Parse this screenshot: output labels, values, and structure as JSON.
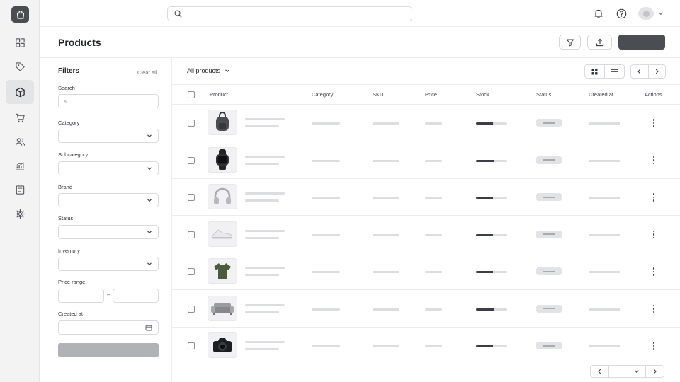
{
  "rail": {
    "items": [
      {
        "icon": "dashboard-grid-icon"
      },
      {
        "icon": "tag-icon"
      },
      {
        "icon": "box-icon",
        "active": true
      },
      {
        "icon": "cart-icon"
      },
      {
        "icon": "users-icon"
      },
      {
        "icon": "analytics-icon"
      },
      {
        "icon": "document-icon"
      },
      {
        "icon": "settings-icon"
      }
    ]
  },
  "topbar": {
    "search_placeholder": "",
    "icons": [
      "bell-icon",
      "help-icon"
    ]
  },
  "page": {
    "title": "Products",
    "primary_button_label": ""
  },
  "filters": {
    "title": "Filters",
    "clear_label": "Clear all",
    "search_label": "Search",
    "category_label": "Category",
    "subcategory_label": "Subcategory",
    "brand_label": "Brand",
    "status_label": "Status",
    "inventory_label": "Inventory",
    "price_range_label": "Price range",
    "price_separator": "–",
    "created_at_label": "Created at"
  },
  "list": {
    "view_label": "All products",
    "columns": {
      "product": "Product",
      "category": "Category",
      "sku": "SKU",
      "price": "Price",
      "stock": "Stock",
      "status": "Status",
      "created_at": "Created at",
      "actions": "Actions"
    },
    "rows": [
      {
        "product_image": "backpack",
        "stock_fraction": 0.55
      },
      {
        "product_image": "smartwatch",
        "stock_fraction": 0.6
      },
      {
        "product_image": "headphones",
        "stock_fraction": 0.55
      },
      {
        "product_image": "sneaker",
        "stock_fraction": 0.55
      },
      {
        "product_image": "t-shirt",
        "stock_fraction": 0.55
      },
      {
        "product_image": "sofa",
        "stock_fraction": 0.6
      },
      {
        "product_image": "camera",
        "stock_fraction": 0.55
      }
    ]
  },
  "colors": {
    "accent": "#4a4d52",
    "rail_bg": "#f3f3f4",
    "skeleton": "#dcdde0"
  }
}
